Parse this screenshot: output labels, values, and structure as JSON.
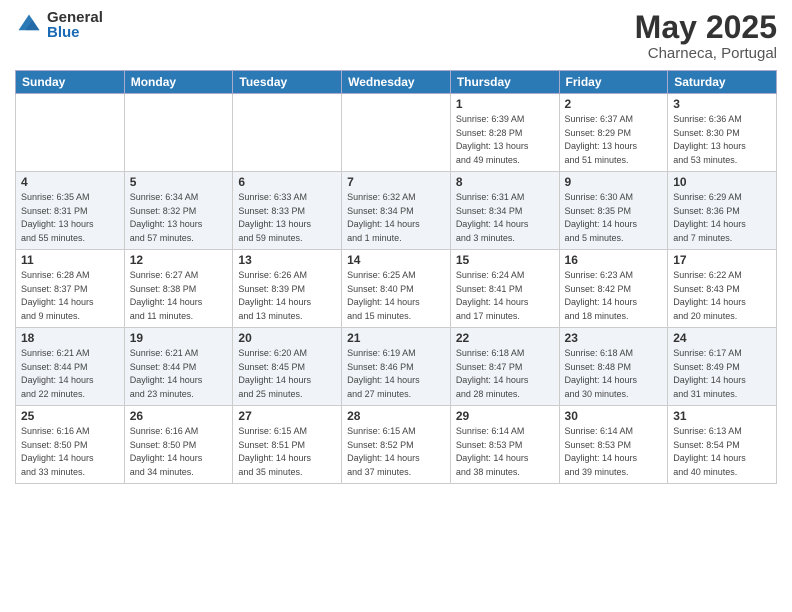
{
  "logo": {
    "general": "General",
    "blue": "Blue"
  },
  "title": {
    "month": "May 2025",
    "location": "Charneca, Portugal"
  },
  "weekdays": [
    "Sunday",
    "Monday",
    "Tuesday",
    "Wednesday",
    "Thursday",
    "Friday",
    "Saturday"
  ],
  "weeks": [
    [
      {
        "day": "",
        "info": ""
      },
      {
        "day": "",
        "info": ""
      },
      {
        "day": "",
        "info": ""
      },
      {
        "day": "",
        "info": ""
      },
      {
        "day": "1",
        "info": "Sunrise: 6:39 AM\nSunset: 8:28 PM\nDaylight: 13 hours\nand 49 minutes."
      },
      {
        "day": "2",
        "info": "Sunrise: 6:37 AM\nSunset: 8:29 PM\nDaylight: 13 hours\nand 51 minutes."
      },
      {
        "day": "3",
        "info": "Sunrise: 6:36 AM\nSunset: 8:30 PM\nDaylight: 13 hours\nand 53 minutes."
      }
    ],
    [
      {
        "day": "4",
        "info": "Sunrise: 6:35 AM\nSunset: 8:31 PM\nDaylight: 13 hours\nand 55 minutes."
      },
      {
        "day": "5",
        "info": "Sunrise: 6:34 AM\nSunset: 8:32 PM\nDaylight: 13 hours\nand 57 minutes."
      },
      {
        "day": "6",
        "info": "Sunrise: 6:33 AM\nSunset: 8:33 PM\nDaylight: 13 hours\nand 59 minutes."
      },
      {
        "day": "7",
        "info": "Sunrise: 6:32 AM\nSunset: 8:34 PM\nDaylight: 14 hours\nand 1 minute."
      },
      {
        "day": "8",
        "info": "Sunrise: 6:31 AM\nSunset: 8:34 PM\nDaylight: 14 hours\nand 3 minutes."
      },
      {
        "day": "9",
        "info": "Sunrise: 6:30 AM\nSunset: 8:35 PM\nDaylight: 14 hours\nand 5 minutes."
      },
      {
        "day": "10",
        "info": "Sunrise: 6:29 AM\nSunset: 8:36 PM\nDaylight: 14 hours\nand 7 minutes."
      }
    ],
    [
      {
        "day": "11",
        "info": "Sunrise: 6:28 AM\nSunset: 8:37 PM\nDaylight: 14 hours\nand 9 minutes."
      },
      {
        "day": "12",
        "info": "Sunrise: 6:27 AM\nSunset: 8:38 PM\nDaylight: 14 hours\nand 11 minutes."
      },
      {
        "day": "13",
        "info": "Sunrise: 6:26 AM\nSunset: 8:39 PM\nDaylight: 14 hours\nand 13 minutes."
      },
      {
        "day": "14",
        "info": "Sunrise: 6:25 AM\nSunset: 8:40 PM\nDaylight: 14 hours\nand 15 minutes."
      },
      {
        "day": "15",
        "info": "Sunrise: 6:24 AM\nSunset: 8:41 PM\nDaylight: 14 hours\nand 17 minutes."
      },
      {
        "day": "16",
        "info": "Sunrise: 6:23 AM\nSunset: 8:42 PM\nDaylight: 14 hours\nand 18 minutes."
      },
      {
        "day": "17",
        "info": "Sunrise: 6:22 AM\nSunset: 8:43 PM\nDaylight: 14 hours\nand 20 minutes."
      }
    ],
    [
      {
        "day": "18",
        "info": "Sunrise: 6:21 AM\nSunset: 8:44 PM\nDaylight: 14 hours\nand 22 minutes."
      },
      {
        "day": "19",
        "info": "Sunrise: 6:21 AM\nSunset: 8:44 PM\nDaylight: 14 hours\nand 23 minutes."
      },
      {
        "day": "20",
        "info": "Sunrise: 6:20 AM\nSunset: 8:45 PM\nDaylight: 14 hours\nand 25 minutes."
      },
      {
        "day": "21",
        "info": "Sunrise: 6:19 AM\nSunset: 8:46 PM\nDaylight: 14 hours\nand 27 minutes."
      },
      {
        "day": "22",
        "info": "Sunrise: 6:18 AM\nSunset: 8:47 PM\nDaylight: 14 hours\nand 28 minutes."
      },
      {
        "day": "23",
        "info": "Sunrise: 6:18 AM\nSunset: 8:48 PM\nDaylight: 14 hours\nand 30 minutes."
      },
      {
        "day": "24",
        "info": "Sunrise: 6:17 AM\nSunset: 8:49 PM\nDaylight: 14 hours\nand 31 minutes."
      }
    ],
    [
      {
        "day": "25",
        "info": "Sunrise: 6:16 AM\nSunset: 8:50 PM\nDaylight: 14 hours\nand 33 minutes."
      },
      {
        "day": "26",
        "info": "Sunrise: 6:16 AM\nSunset: 8:50 PM\nDaylight: 14 hours\nand 34 minutes."
      },
      {
        "day": "27",
        "info": "Sunrise: 6:15 AM\nSunset: 8:51 PM\nDaylight: 14 hours\nand 35 minutes."
      },
      {
        "day": "28",
        "info": "Sunrise: 6:15 AM\nSunset: 8:52 PM\nDaylight: 14 hours\nand 37 minutes."
      },
      {
        "day": "29",
        "info": "Sunrise: 6:14 AM\nSunset: 8:53 PM\nDaylight: 14 hours\nand 38 minutes."
      },
      {
        "day": "30",
        "info": "Sunrise: 6:14 AM\nSunset: 8:53 PM\nDaylight: 14 hours\nand 39 minutes."
      },
      {
        "day": "31",
        "info": "Sunrise: 6:13 AM\nSunset: 8:54 PM\nDaylight: 14 hours\nand 40 minutes."
      }
    ]
  ]
}
